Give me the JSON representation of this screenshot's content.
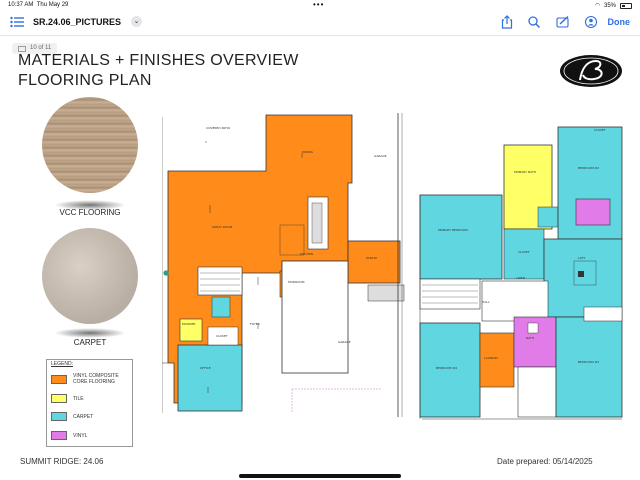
{
  "status": {
    "time": "10:37 AM",
    "date": "Thu May 29",
    "battery": "35%"
  },
  "toolbar": {
    "title": "SR.24.06_PICTURES",
    "done": "Done"
  },
  "page": {
    "counter": "10 of 11",
    "title_line1": "MATERIALS + FINISHES OVERVIEW",
    "title_line2": "FLOORING PLAN",
    "swatch1_label": "VCC FLOORING",
    "swatch2_label": "CARPET",
    "legend": {
      "title": "LEGEND:",
      "items": [
        {
          "label": "VINYL COMPOSITE CORE FLOORING",
          "color": "#ff8c1a"
        },
        {
          "label": "TILE",
          "color": "#ffff66"
        },
        {
          "label": "CARPET",
          "color": "#5fd6e0"
        },
        {
          "label": "VINYL",
          "color": "#e07be8"
        }
      ]
    },
    "footer_left": "SUMMIT RIDGE: 24.06",
    "footer_right": "Date prepared: 05/14/2025"
  },
  "plan_labels": {
    "covered_patio": "COVERED PATIO",
    "dining": "DINING",
    "garage": "GARAGE",
    "great_room": "GREAT ROOM",
    "kitchen": "KITCHEN",
    "pantry": "PANTRY",
    "mudroom": "MUDROOM",
    "powder": "POWDER",
    "closet": "CLOSET",
    "foyer": "FOYER",
    "office": "OFFICE",
    "garage2": "GARAGE",
    "primary_bath": "PRIMARY BATH",
    "primary_bedroom": "PRIMARY BEDROOM",
    "bedroom2": "BEDROOM #2",
    "bedroom3": "BEDROOM #3",
    "bedroom4": "BEDROOM #4",
    "laundry": "LAUNDRY",
    "bath": "BATH",
    "loft": "LOFT",
    "linen": "LINEN",
    "hall": "HALL",
    "wic": "CLOSET"
  },
  "colors": {
    "vcc": "#ff8c1a",
    "tile": "#ffff66",
    "carpet": "#5fd6e0",
    "vinyl": "#e07be8",
    "accent": "#2f6fe0"
  }
}
